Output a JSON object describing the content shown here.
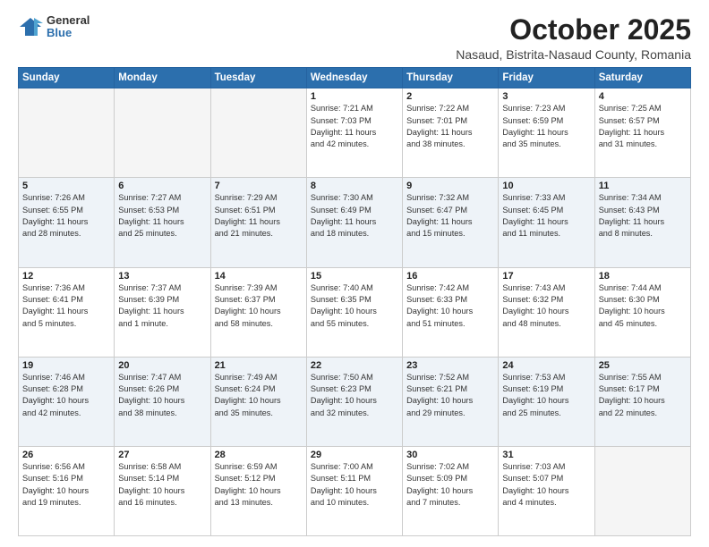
{
  "header": {
    "logo": {
      "line1": "General",
      "line2": "Blue"
    },
    "title": "October 2025",
    "subtitle": "Nasaud, Bistrita-Nasaud County, Romania"
  },
  "days_of_week": [
    "Sunday",
    "Monday",
    "Tuesday",
    "Wednesday",
    "Thursday",
    "Friday",
    "Saturday"
  ],
  "weeks": [
    {
      "alt": false,
      "days": [
        {
          "num": "",
          "info": ""
        },
        {
          "num": "",
          "info": ""
        },
        {
          "num": "",
          "info": ""
        },
        {
          "num": "1",
          "info": "Sunrise: 7:21 AM\nSunset: 7:03 PM\nDaylight: 11 hours\nand 42 minutes."
        },
        {
          "num": "2",
          "info": "Sunrise: 7:22 AM\nSunset: 7:01 PM\nDaylight: 11 hours\nand 38 minutes."
        },
        {
          "num": "3",
          "info": "Sunrise: 7:23 AM\nSunset: 6:59 PM\nDaylight: 11 hours\nand 35 minutes."
        },
        {
          "num": "4",
          "info": "Sunrise: 7:25 AM\nSunset: 6:57 PM\nDaylight: 11 hours\nand 31 minutes."
        }
      ]
    },
    {
      "alt": true,
      "days": [
        {
          "num": "5",
          "info": "Sunrise: 7:26 AM\nSunset: 6:55 PM\nDaylight: 11 hours\nand 28 minutes."
        },
        {
          "num": "6",
          "info": "Sunrise: 7:27 AM\nSunset: 6:53 PM\nDaylight: 11 hours\nand 25 minutes."
        },
        {
          "num": "7",
          "info": "Sunrise: 7:29 AM\nSunset: 6:51 PM\nDaylight: 11 hours\nand 21 minutes."
        },
        {
          "num": "8",
          "info": "Sunrise: 7:30 AM\nSunset: 6:49 PM\nDaylight: 11 hours\nand 18 minutes."
        },
        {
          "num": "9",
          "info": "Sunrise: 7:32 AM\nSunset: 6:47 PM\nDaylight: 11 hours\nand 15 minutes."
        },
        {
          "num": "10",
          "info": "Sunrise: 7:33 AM\nSunset: 6:45 PM\nDaylight: 11 hours\nand 11 minutes."
        },
        {
          "num": "11",
          "info": "Sunrise: 7:34 AM\nSunset: 6:43 PM\nDaylight: 11 hours\nand 8 minutes."
        }
      ]
    },
    {
      "alt": false,
      "days": [
        {
          "num": "12",
          "info": "Sunrise: 7:36 AM\nSunset: 6:41 PM\nDaylight: 11 hours\nand 5 minutes."
        },
        {
          "num": "13",
          "info": "Sunrise: 7:37 AM\nSunset: 6:39 PM\nDaylight: 11 hours\nand 1 minute."
        },
        {
          "num": "14",
          "info": "Sunrise: 7:39 AM\nSunset: 6:37 PM\nDaylight: 10 hours\nand 58 minutes."
        },
        {
          "num": "15",
          "info": "Sunrise: 7:40 AM\nSunset: 6:35 PM\nDaylight: 10 hours\nand 55 minutes."
        },
        {
          "num": "16",
          "info": "Sunrise: 7:42 AM\nSunset: 6:33 PM\nDaylight: 10 hours\nand 51 minutes."
        },
        {
          "num": "17",
          "info": "Sunrise: 7:43 AM\nSunset: 6:32 PM\nDaylight: 10 hours\nand 48 minutes."
        },
        {
          "num": "18",
          "info": "Sunrise: 7:44 AM\nSunset: 6:30 PM\nDaylight: 10 hours\nand 45 minutes."
        }
      ]
    },
    {
      "alt": true,
      "days": [
        {
          "num": "19",
          "info": "Sunrise: 7:46 AM\nSunset: 6:28 PM\nDaylight: 10 hours\nand 42 minutes."
        },
        {
          "num": "20",
          "info": "Sunrise: 7:47 AM\nSunset: 6:26 PM\nDaylight: 10 hours\nand 38 minutes."
        },
        {
          "num": "21",
          "info": "Sunrise: 7:49 AM\nSunset: 6:24 PM\nDaylight: 10 hours\nand 35 minutes."
        },
        {
          "num": "22",
          "info": "Sunrise: 7:50 AM\nSunset: 6:23 PM\nDaylight: 10 hours\nand 32 minutes."
        },
        {
          "num": "23",
          "info": "Sunrise: 7:52 AM\nSunset: 6:21 PM\nDaylight: 10 hours\nand 29 minutes."
        },
        {
          "num": "24",
          "info": "Sunrise: 7:53 AM\nSunset: 6:19 PM\nDaylight: 10 hours\nand 25 minutes."
        },
        {
          "num": "25",
          "info": "Sunrise: 7:55 AM\nSunset: 6:17 PM\nDaylight: 10 hours\nand 22 minutes."
        }
      ]
    },
    {
      "alt": false,
      "days": [
        {
          "num": "26",
          "info": "Sunrise: 6:56 AM\nSunset: 5:16 PM\nDaylight: 10 hours\nand 19 minutes."
        },
        {
          "num": "27",
          "info": "Sunrise: 6:58 AM\nSunset: 5:14 PM\nDaylight: 10 hours\nand 16 minutes."
        },
        {
          "num": "28",
          "info": "Sunrise: 6:59 AM\nSunset: 5:12 PM\nDaylight: 10 hours\nand 13 minutes."
        },
        {
          "num": "29",
          "info": "Sunrise: 7:00 AM\nSunset: 5:11 PM\nDaylight: 10 hours\nand 10 minutes."
        },
        {
          "num": "30",
          "info": "Sunrise: 7:02 AM\nSunset: 5:09 PM\nDaylight: 10 hours\nand 7 minutes."
        },
        {
          "num": "31",
          "info": "Sunrise: 7:03 AM\nSunset: 5:07 PM\nDaylight: 10 hours\nand 4 minutes."
        },
        {
          "num": "",
          "info": ""
        }
      ]
    }
  ]
}
